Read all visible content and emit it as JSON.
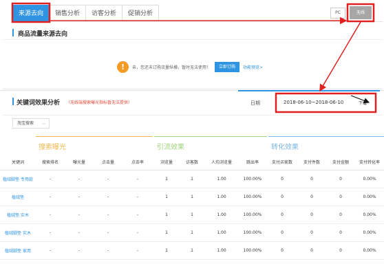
{
  "tabs": [
    {
      "label": "来源去向",
      "active": true
    },
    {
      "label": "销售分析",
      "active": false
    },
    {
      "label": "访客分析",
      "active": false
    },
    {
      "label": "促销分析",
      "active": false
    }
  ],
  "platform": {
    "pc_label": "PC",
    "wireless_label": "无线"
  },
  "section1": {
    "title": "商品流量来源去向"
  },
  "notice": {
    "icon_text": "!",
    "text": "亲，您还未订购流量纵横，暂时无法使用！",
    "subscribe_label": "立即订购",
    "preview_label": "功能预览>"
  },
  "section2": {
    "title": "关键词效果分析",
    "note": "（无线端搜索曝光指标暂无法提供）",
    "date_label": "日期",
    "date_range": "2018-06-10~2018-06-10",
    "download_label": "下载"
  },
  "filter": {
    "selected": "淘宝搜索"
  },
  "groups": [
    "搜索曝光",
    "引流效果",
    "转化效果"
  ],
  "columns": [
    "关键词",
    "搜索排名",
    "曝光量",
    "点击量",
    "点击率",
    "浏览量",
    "访客数",
    "人均浏览量",
    "跳出率",
    "支付买家数",
    "支付件数",
    "支付金额",
    "支付转化率"
  ],
  "rows": [
    [
      "植绒脚垫 专用款",
      "-",
      "-",
      "-",
      "-",
      "1",
      "1",
      "1.00",
      "100.00%",
      "0",
      "0",
      "0",
      "0.00%"
    ],
    [
      "植绒垫",
      "-",
      "-",
      "-",
      "-",
      "1",
      "1",
      "1.00",
      "100.00%",
      "0",
      "0",
      "0",
      "0.00%"
    ],
    [
      "植绒垫 实木",
      "-",
      "-",
      "-",
      "-",
      "1",
      "1",
      "1.00",
      "100.00%",
      "0",
      "0",
      "0",
      "0.00%"
    ],
    [
      "植绒脚垫 实木",
      "-",
      "-",
      "-",
      "-",
      "1",
      "1",
      "1.00",
      "100.00%",
      "0",
      "0",
      "0",
      "0.00%"
    ],
    [
      "植绒脚垫 家用",
      "-",
      "-",
      "-",
      "-",
      "1",
      "1",
      "1.00",
      "100.00%",
      "0",
      "0",
      "0",
      "0.00%"
    ]
  ],
  "colors": {
    "accent": "#2f95e3",
    "highlight": "#e02020",
    "warning": "#f59a23",
    "exposure": "#f2b94f",
    "traffic": "#9ed57c",
    "conversion": "#7cb7e8"
  }
}
